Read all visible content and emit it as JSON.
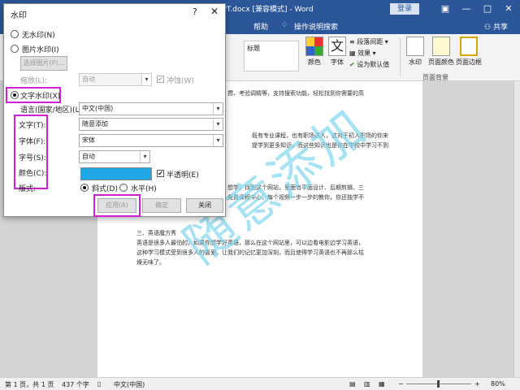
{
  "window": {
    "title": "PPT.docx [兼容模式] - Word",
    "login": "登录",
    "minimize": "—",
    "restore": "□",
    "close": "✕"
  },
  "tabs": [
    {
      "label": "帮助"
    },
    {
      "label": "操作说明搜索"
    }
  ],
  "share": "共享",
  "ribbon": {
    "style_label": "标题",
    "colors": "颜色",
    "fonts": "字体",
    "text_label": "文",
    "paragraph_spacing": "段落间距",
    "effects": "效果",
    "set_default": "设为默认值",
    "watermark": "水印",
    "page_color": "页面颜色",
    "page_borders": "页面边框",
    "group_page_background": "页面背景"
  },
  "document": {
    "lines": [
      "攒、考验调精等，支持搜索功能，轻松找到你需要的高",
      "既有专业课程，也有职场达人，这对于初入职场的你来",
      "提学到更多知识，而这些知识也是你在学校中学习不到",
      "想学，找到这个网站，里面有平面设计、后期剪辑、三",
      "免费课程中心，每个视频一步一步的教你，你还独学不",
      "三、英语魔方秀",
      "英语是很多人最怕的，如果你想学好英语，那么在这个网站里，可以边看电影边学习英语，",
      "这种学习模式受到很多人的喜爱，让我们的记忆更加深刻，而且使得学习英语也不再那么枯",
      "燥无味了。"
    ],
    "watermark_text": "随意添加"
  },
  "statusbar": {
    "page": "第 1 页，共 1 页",
    "words": "437 个字",
    "language": "中文(中国)",
    "zoom": "80%",
    "zoom_minus": "−",
    "zoom_plus": "+"
  },
  "dialog": {
    "title": "水印",
    "help": "?",
    "close": "✕",
    "no_watermark": "无水印(N)",
    "picture_watermark": "图片水印(I)",
    "select_picture": "选择图片(P)...",
    "scale_label": "缩放(L):",
    "scale_value": "自动",
    "washout_label": "冲蚀(W)",
    "text_watermark": "文字水印(X)",
    "language_label": "语言(国家/地区)(L):",
    "language_value": "中文(中国)",
    "text_label": "文字(T):",
    "text_value": "随意添加",
    "font_label": "字体(F):",
    "font_value": "宋体",
    "size_label": "字号(S):",
    "size_value": "自动",
    "color_label": "颜色(C):",
    "color_hex": "#1fa6e6",
    "semitransparent": "半透明(E)",
    "layout_label": "版式:",
    "diagonal": "斜式(D)",
    "horizontal": "水平(H)",
    "apply": "应用(A)",
    "ok": "确定",
    "close_btn": "关闭",
    "selected_option": "text_watermark",
    "semitransparent_checked": true,
    "washout_checked": true,
    "layout_selected": "diagonal",
    "highlight_color": "#d01fd6"
  }
}
